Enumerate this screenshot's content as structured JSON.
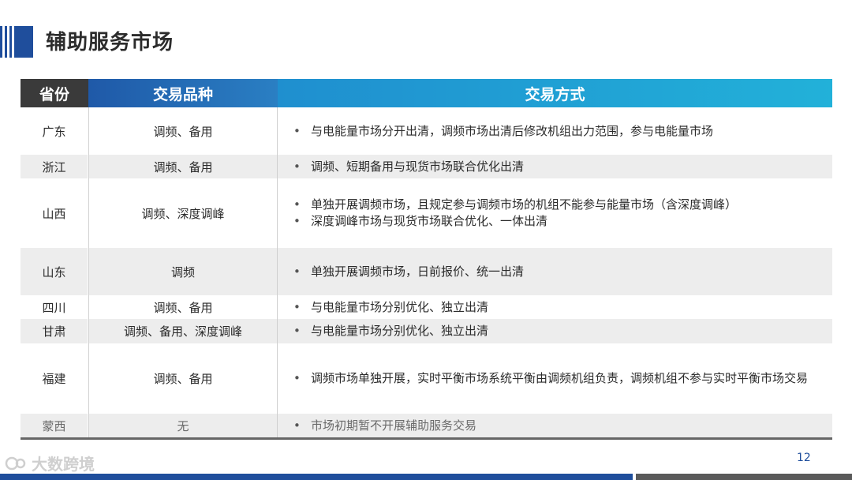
{
  "header": {
    "title": "辅助服务市场"
  },
  "colors": {
    "accent_dark": "#1f4e9c",
    "header_dark": "#3a3a3a",
    "header_mid": "#2a7fc3",
    "header_light": "#22b1d9",
    "row_shade": "#ededed"
  },
  "table": {
    "headers": [
      "省份",
      "交易品种",
      "交易方式"
    ],
    "rows": [
      {
        "province": "广东",
        "type": "调频、备用",
        "methods": [
          "与电能量市场分开出清，调频市场出清后修改机组出力范围，参与电能量市场"
        ]
      },
      {
        "province": "浙江",
        "type": "调频、备用",
        "methods": [
          "调频、短期备用与现货市场联合优化出清"
        ]
      },
      {
        "province": "山西",
        "type": "调频、深度调峰",
        "methods": [
          "单独开展调频市场，且规定参与调频市场的机组不能参与能量市场（含深度调峰）",
          "深度调峰市场与现货市场联合优化、一体出清"
        ]
      },
      {
        "province": "山东",
        "type": "调频",
        "methods": [
          "单独开展调频市场，日前报价、统一出清"
        ]
      },
      {
        "province": "四川",
        "type": "调频、备用",
        "methods": [
          "与电能量市场分别优化、独立出清"
        ]
      },
      {
        "province": "甘肃",
        "type": "调频、备用、深度调峰",
        "methods": [
          "与电能量市场分别优化、独立出清"
        ]
      },
      {
        "province": "福建",
        "type": "调频、备用",
        "methods": [
          "调频市场单独开展，实时平衡市场系统平衡由调频机组负责，调频机组不参与实时平衡市场交易"
        ]
      },
      {
        "province": "蒙西",
        "type": "无",
        "methods": [
          "市场初期暂不开展辅助服务交易"
        ]
      }
    ]
  },
  "footer": {
    "watermark": "大数跨境",
    "page_number": "12"
  }
}
